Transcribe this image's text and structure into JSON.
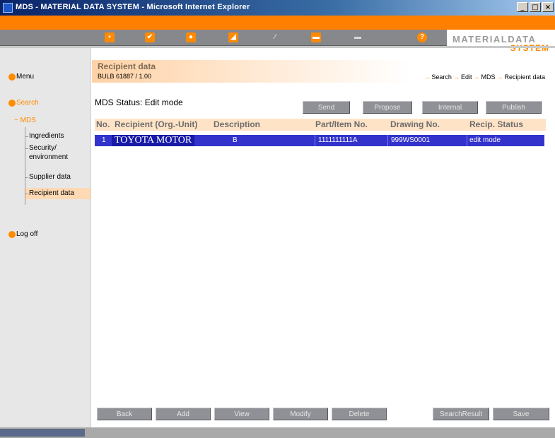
{
  "window": {
    "title": "MDS - MATERIAL DATA SYSTEM - Microsoft Internet Explorer",
    "controls": [
      "_",
      "□",
      "×"
    ]
  },
  "toolbar": {
    "icons": [
      "save-icon",
      "check-icon",
      "search-icon",
      "edit-icon",
      "pen-icon",
      "print-icon",
      "printer-icon",
      "help-icon"
    ]
  },
  "brand": {
    "line1": "MATERIALDATA",
    "line2": "SYSTEM"
  },
  "sidebar": {
    "menu": "Menu",
    "search": "Search",
    "mds": "MDS",
    "items": [
      "Ingredients",
      "Security/",
      "environment",
      "Supplier data",
      "Recipient data"
    ],
    "logoff": "Log off"
  },
  "header": {
    "title": "Recipient data",
    "subtitle": "BULB 61887 / 1.00",
    "breadcrumb": [
      "Search",
      "Edit",
      "MDS",
      "Recipient data"
    ]
  },
  "status": {
    "text": "MDS Status: Edit mode"
  },
  "actions": {
    "send": "Send",
    "propose": "Propose",
    "internal": "Internal",
    "publish": "Publish"
  },
  "table": {
    "columns": [
      "No.",
      "Recipient (Org.-Unit)",
      "Description",
      "Part/Item No.",
      "Drawing No.",
      "Recip. Status"
    ],
    "rows": [
      {
        "no": "1",
        "recipient": "TOYOTA MOTOR",
        "description": "B",
        "part": "1111111111A",
        "drawing": "999WS0001",
        "status": "edit mode"
      }
    ]
  },
  "bottom": {
    "back": "Back",
    "add": "Add",
    "view": "View",
    "modify": "Modify",
    "delete": "Delete",
    "search_result": "SearchResult",
    "save": "Save"
  },
  "colors": {
    "orange": "#ff7f00",
    "selection": "#3333cc",
    "toolbar": "#86888c"
  }
}
